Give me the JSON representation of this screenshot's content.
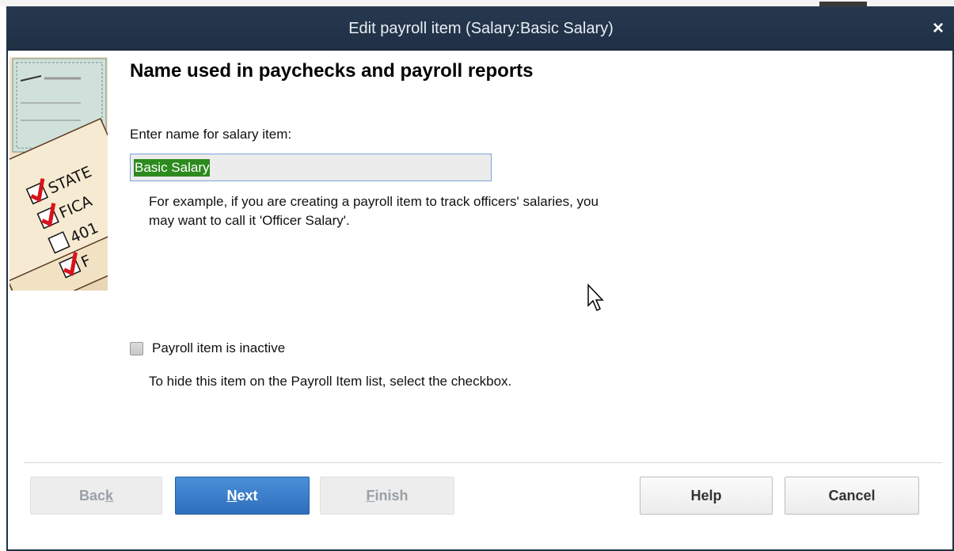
{
  "window": {
    "title": "Edit payroll item (Salary:Basic Salary)",
    "close_glyph": "×"
  },
  "illustration": {
    "labels": [
      "STATE",
      "FICA",
      "401",
      "F"
    ],
    "description_icon": "payroll-checklist-illustration"
  },
  "page": {
    "heading": "Name used in paychecks and payroll reports",
    "field_label": "Enter name for salary item:",
    "name_value": "Basic Salary",
    "hint_line1": "For example, if you are creating a payroll item to track officers' salaries, you",
    "hint_line2": "may want to call it 'Officer Salary'.",
    "inactive_label": "Payroll item is inactive",
    "inactive_checked": false,
    "inactive_hint": "To hide this item on the Payroll Item list, select the checkbox."
  },
  "buttons": {
    "back": {
      "pre": "Bac",
      "ul": "k",
      "post": ""
    },
    "next": {
      "pre": "",
      "ul": "N",
      "post": "ext"
    },
    "finish": {
      "pre": "",
      "ul": "F",
      "post": "inish"
    },
    "help": "Help",
    "cancel": "Cancel"
  },
  "colors": {
    "titlebar": "#23354b",
    "primary_button": "#3a7fcf",
    "selection": "#2d8a1f",
    "check_red": "#d9121b"
  }
}
